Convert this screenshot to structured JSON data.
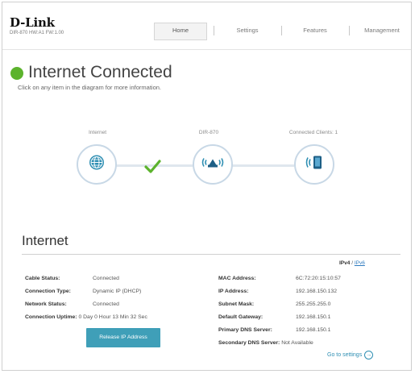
{
  "header": {
    "logo": "D-Link",
    "logo_sub": "DIR-870 HW:A1 FW:1.00",
    "nav": [
      {
        "label": "Home",
        "active": true
      },
      {
        "label": "Settings",
        "active": false
      },
      {
        "label": "Features",
        "active": false
      },
      {
        "label": "Management",
        "active": false
      }
    ]
  },
  "status": {
    "title": "Internet Connected",
    "subtitle": "Click on any item in the diagram for more information.",
    "color": "#5cb32d"
  },
  "diagram": {
    "internet_label": "Internet",
    "router_label": "DIR-870",
    "clients_label": "Connected Clients: 1",
    "icons": {
      "internet": "globe-icon",
      "router": "router-icon",
      "clients": "wireless-device-icon",
      "link": "checkmark-icon"
    }
  },
  "internet": {
    "title": "Internet",
    "ipv4": "IPv4",
    "separator": "/",
    "ipv6": "IPv6",
    "left": [
      {
        "key": "Cable Status:",
        "value": "Connected"
      },
      {
        "key": "Connection Type:",
        "value": "Dynamic IP (DHCP)"
      },
      {
        "key": "Network Status:",
        "value": "Connected"
      },
      {
        "key": "Connection Uptime:",
        "value": "0 Day 0 Hour 13 Min 32 Sec"
      }
    ],
    "right": [
      {
        "key": "MAC Address:",
        "value": "6C:72:20:15:10:57"
      },
      {
        "key": "IP Address:",
        "value": "192.168.150.132"
      },
      {
        "key": "Subnet Mask:",
        "value": "255.255.255.0"
      },
      {
        "key": "Default Gateway:",
        "value": "192.168.150.1"
      },
      {
        "key": "Primary DNS Server:",
        "value": "192.168.150.1"
      },
      {
        "key": "Secondary DNS Server:",
        "value": "Not Available"
      }
    ],
    "release_button": "Release IP Address",
    "goto_settings": "Go to settings"
  }
}
